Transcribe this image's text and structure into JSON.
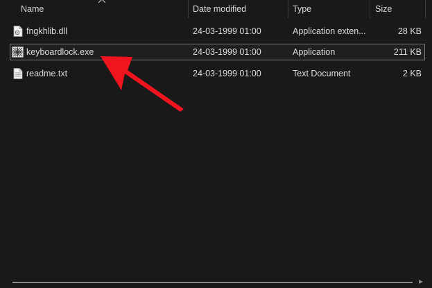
{
  "columns": {
    "name": "Name",
    "date_modified": "Date modified",
    "type": "Type",
    "size": "Size"
  },
  "files": [
    {
      "name": "fngkhlib.dll",
      "date": "24-03-1999 01:00",
      "type": "Application exten...",
      "size": "28 KB",
      "icon": "dll-file-icon"
    },
    {
      "name": "keyboardlock.exe",
      "date": "24-03-1999 01:00",
      "type": "Application",
      "size": "211 KB",
      "icon": "exe-file-icon"
    },
    {
      "name": "readme.txt",
      "date": "24-03-1999 01:00",
      "type": "Text Document",
      "size": "2 KB",
      "icon": "text-file-icon"
    }
  ],
  "selected_index": 1,
  "colors": {
    "background": "#191919",
    "text": "#dcdcdc",
    "annotation_arrow": "#f0141e"
  }
}
